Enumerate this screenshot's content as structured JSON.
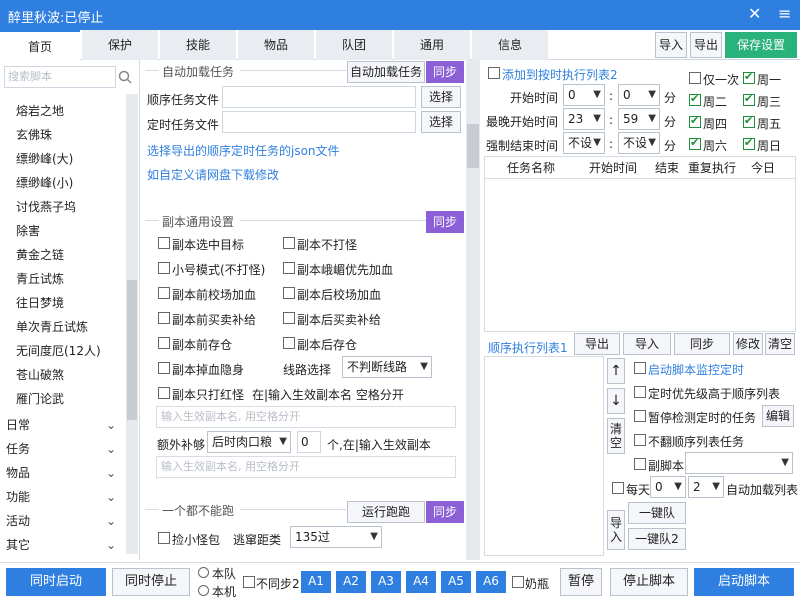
{
  "window": {
    "title": "醉里秋波:已停止",
    "close": "✕",
    "menu": "≡"
  },
  "tabs": [
    "首页",
    "保护",
    "技能",
    "物品",
    "队团",
    "通用",
    "信息"
  ],
  "toolbar": {
    "import": "导入",
    "export": "导出",
    "save": "保存设置"
  },
  "sidebar": {
    "search_placeholder": "搜索脚本",
    "items": [
      "熔岩之地",
      "玄佛珠",
      "缥缈峰(大)",
      "缥缈峰(小)",
      "讨伐燕子坞",
      "除害",
      "黄金之链",
      "青丘试炼",
      "往日梦境",
      "单次青丘试炼",
      "无间度厄(12人)",
      "苍山破煞",
      "雁门论武"
    ],
    "groups": [
      "日常",
      "任务",
      "物品",
      "功能",
      "活动",
      "其它"
    ]
  },
  "auto_task": {
    "title": "自动加载任务",
    "load_button": "自动加载任务",
    "sync": "同步",
    "seq_label": "顺序任务文件",
    "timer_label": "定时任务文件",
    "select": "选择",
    "link1": "选择导出的顺序定时任务的json文件",
    "link2": "如自定义请网盘下载修改"
  },
  "dungeon": {
    "title": "副本通用设置",
    "sync": "同步",
    "options_left": [
      "副本选中目标",
      "小号模式(不打怪)",
      "副本前校场加血",
      "副本前买卖补给",
      "副本前存仓",
      "副本掉血隐身",
      "副本只打红怪"
    ],
    "options_right": [
      "副本不打怪",
      "副本峨嵋优先加血",
      "副本后校场加血",
      "副本后买卖补给",
      "副本后存仓"
    ],
    "route_label": "线路选择",
    "route_value": "不判断线路",
    "only_red_hint": "在|输入生效副本名 空格分开",
    "input_placeholder": "输入生效副本名, 用空格分开",
    "extra_label": "额外补够",
    "extra_value": "后时肉口粮",
    "extra_count": "0",
    "extra_hint": "个,在|输入生效副本"
  },
  "run": {
    "title": "一个都不能跑",
    "run_button": "运行跑跑",
    "sync": "同步",
    "pickup": "捡小怪包",
    "escape_label": "逃窜距类",
    "escape_value": "135过"
  },
  "schedule": {
    "add_label": "添加到按时执行列表2",
    "start_label": "开始时间",
    "latest_label": "最晚开始时间",
    "force_end_label": "强制结束时间",
    "start_h": "0",
    "start_m": "0",
    "latest_h": "23",
    "latest_m": "59",
    "end_h": "不设",
    "end_m": "不设",
    "unit": "分",
    "once": "仅一次",
    "days": [
      "周一",
      "周二",
      "周三",
      "周四",
      "周五",
      "周六",
      "周日"
    ],
    "columns": [
      "任务名称",
      "开始时间",
      "结束",
      "重复执行",
      "今日"
    ]
  },
  "seq": {
    "title": "顺序执行列表1",
    "export": "导出",
    "import": "导入",
    "sync": "同步",
    "edit": "修改",
    "clear": "清空",
    "up": "↑",
    "down": "↓",
    "clear_v": "清空",
    "import_v": "导入",
    "options": [
      "启动脚本监控定时",
      "定时优先级高于顺序列表",
      "暂停检测定时的任务",
      "不翻顺序列表任务"
    ],
    "edit_btn": "编辑",
    "sub_script": "副脚本",
    "daily": "每天",
    "daily_a": "0",
    "daily_b": "2",
    "auto_label": "自动加载列表",
    "one_team": "一键队",
    "one_team2": "一键队2"
  },
  "bottom": {
    "sync_start": "同时启动",
    "sync_stop": "同时停止",
    "team": "本队",
    "machine": "本机",
    "nosync": "不同步2",
    "a_buttons": [
      "A1",
      "A2",
      "A3",
      "A4",
      "A5",
      "A6"
    ],
    "nanny": "奶瓶",
    "pause": "暂停",
    "stop": "停止脚本",
    "start": "启动脚本"
  }
}
